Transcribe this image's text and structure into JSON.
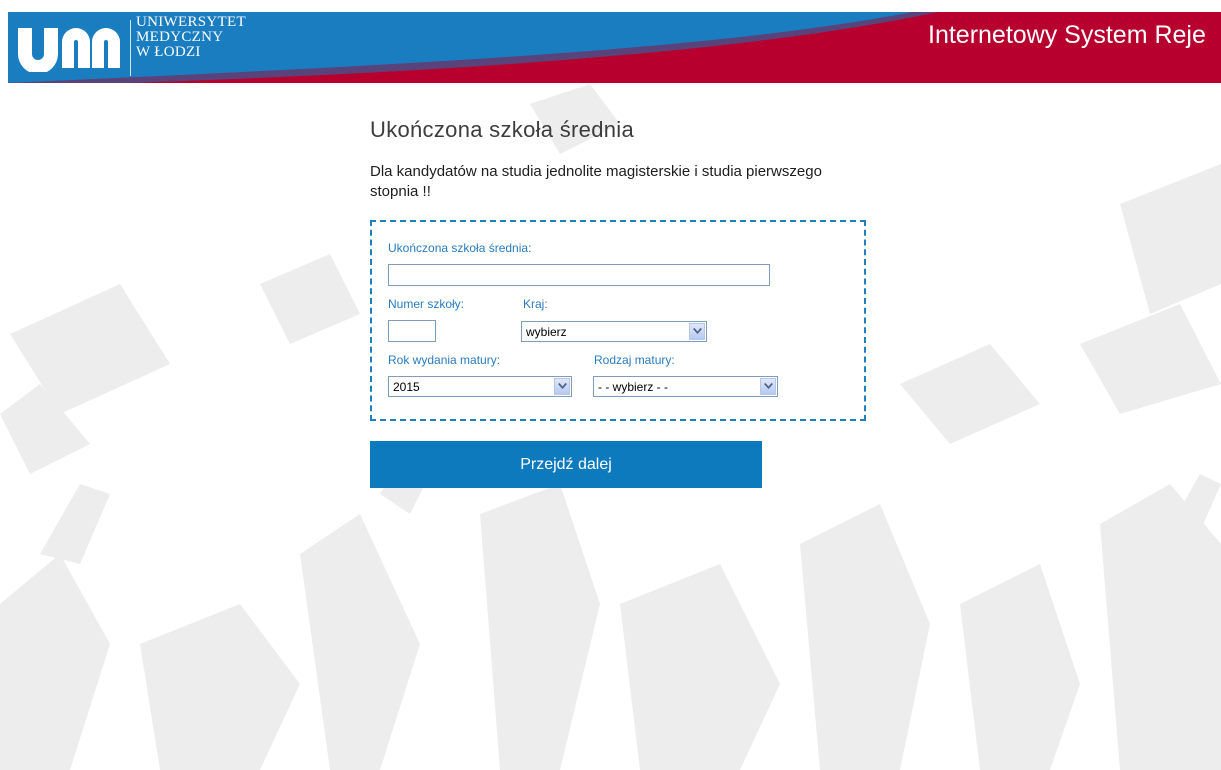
{
  "header": {
    "logo_mark": "um",
    "logo_lines": [
      "UNIWERSYTET",
      "MEDYCZNY",
      "W ŁODZI"
    ],
    "system_title": "Internetowy System Reje",
    "colors": {
      "blue": "#1a7dc0",
      "red": "#b7002d"
    }
  },
  "page": {
    "title": "Ukończona szkoła średnia",
    "notice": "Dla kandydatów na studia jednolite magisterskie i studia pierwszego stopnia !!"
  },
  "form": {
    "school": {
      "label": "Ukończona szkoła średnia:",
      "value": ""
    },
    "school_number": {
      "label": "Numer szkoły:",
      "value": ""
    },
    "country": {
      "label": "Kraj:",
      "selected": "wybierz"
    },
    "exam_year": {
      "label": "Rok wydania matury:",
      "selected": "2015"
    },
    "exam_type": {
      "label": "Rodzaj matury:",
      "selected": "- - wybierz - -"
    }
  },
  "actions": {
    "next_label": "Przejdź dalej"
  },
  "icons": {
    "select_arrow": "chevron-down-icon"
  }
}
